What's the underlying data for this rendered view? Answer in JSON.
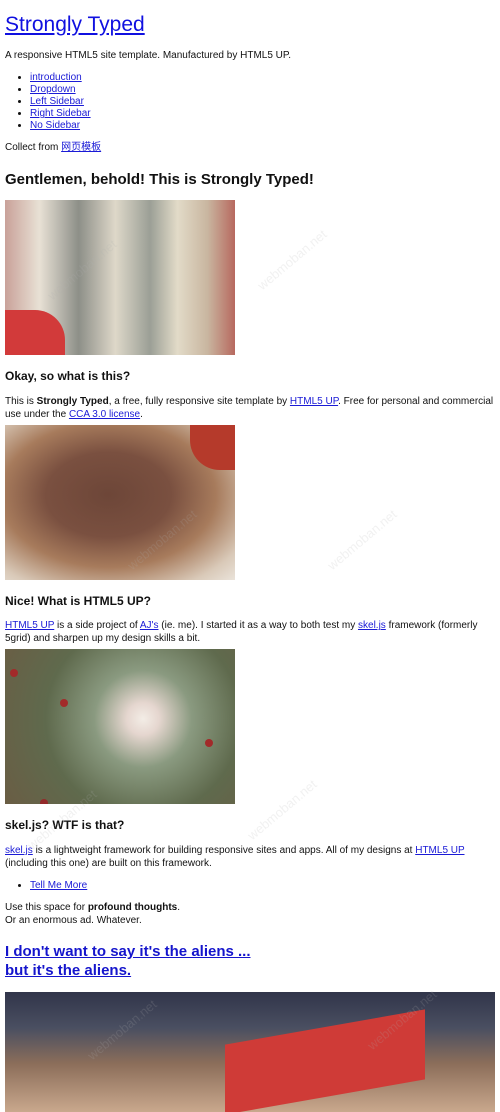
{
  "header": {
    "site_title": "Strongly Typed",
    "tagline": "A responsive HTML5 site template. Manufactured by HTML5 UP."
  },
  "nav": {
    "items": [
      {
        "label": "introduction"
      },
      {
        "label": "Dropdown"
      },
      {
        "label": "Left Sidebar"
      },
      {
        "label": "Right Sidebar"
      },
      {
        "label": "No Sidebar"
      }
    ]
  },
  "collect": {
    "prefix": "Collect from ",
    "link": "网页模板"
  },
  "banner": {
    "heading": "Gentlemen, behold! This is Strongly Typed!"
  },
  "section1": {
    "heading": "Okay, so what is this?",
    "text_a": "This is ",
    "strong": "Strongly Typed",
    "text_b": ", a free, fully responsive site template by ",
    "link1": "HTML5 UP",
    "text_c": ". Free for personal and commercial use under the ",
    "link2": "CCA 3.0 license",
    "text_d": "."
  },
  "section2": {
    "heading": "Nice! What is HTML5 UP?",
    "link1": "HTML5 UP",
    "text_a": " is a side project of ",
    "link2": "AJ's",
    "text_b": " (ie. me). I started it as a way to both test my ",
    "link3": "skel.js",
    "text_c": " framework (formerly 5grid) and sharpen up my design skills a bit."
  },
  "section3": {
    "heading": "skel.js? WTF is that?",
    "link1": "skel.js",
    "text_a": " is a lightweight framework for building responsive sites and apps. All of my designs at ",
    "link2": "HTML5 UP",
    "text_b": " (including this one) are built on this framework.",
    "more_link": "Tell Me More",
    "note_a": "Use this space for ",
    "note_strong": "profound thoughts",
    "note_b": ".",
    "note_line2": "Or an enormous ad. Whatever."
  },
  "section4": {
    "heading_line1": "I don't want to say it's the aliens ...",
    "heading_line2": "but it's the aliens."
  },
  "watermark": {
    "text": "webmoban.net"
  }
}
